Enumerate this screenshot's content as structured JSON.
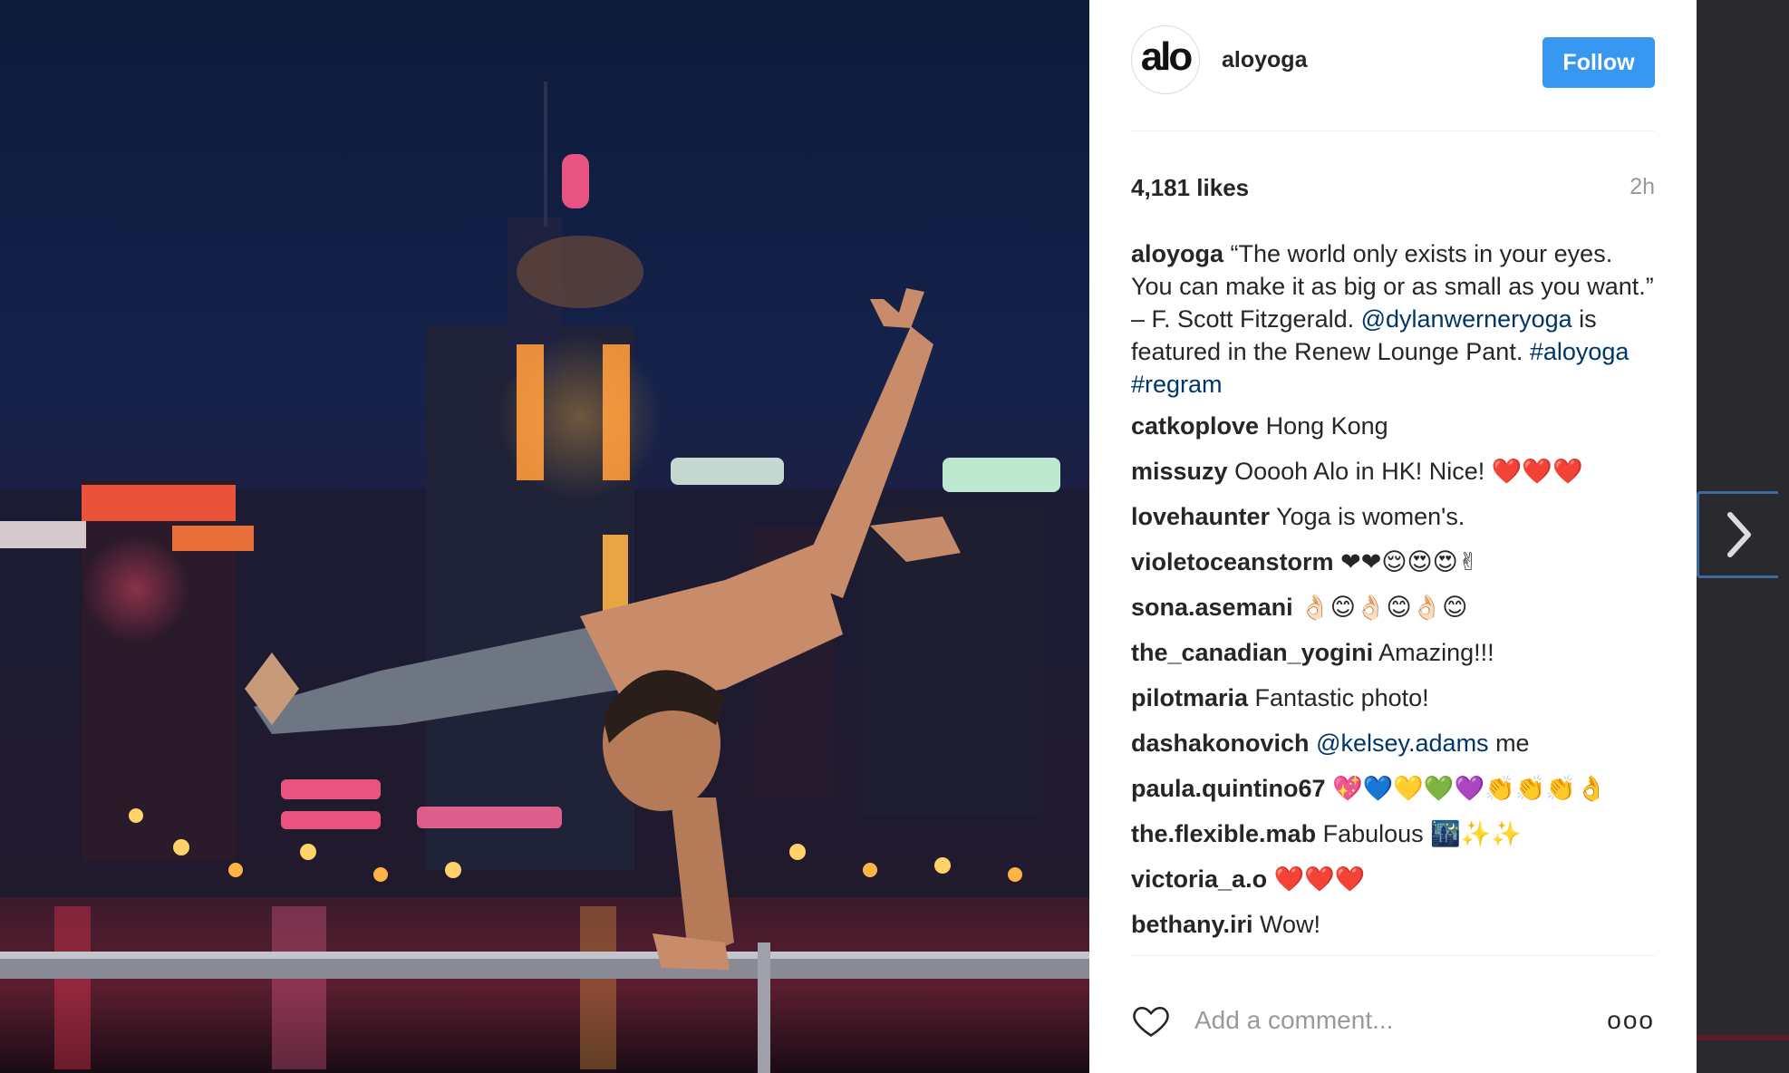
{
  "post": {
    "username": "aloyoga",
    "avatar_text": "alo",
    "follow_label": "Follow",
    "likes": "4,181 likes",
    "time": "2h"
  },
  "caption": {
    "author": "aloyoga",
    "text_1": " “The world only exists in your eyes. You can make it as big or as small as you want.” – F. Scott Fitzgerald. ",
    "mention": "@dylanwerneryoga",
    "text_2": " is featured in the Renew Lounge Pant. ",
    "tag_1": "#aloyoga",
    "tag_2": "#regram"
  },
  "comments": [
    {
      "author": "catkoplove",
      "text": "Hong Kong"
    },
    {
      "author": "missuzy",
      "text": "Ooooh Alo in HK! Nice! ❤️❤️❤️"
    },
    {
      "author": "lovehaunter",
      "text": "Yoga is women's."
    },
    {
      "author": "violetoceanstorm",
      "text": "❤❤😌😍😍✌"
    },
    {
      "author": "sona.asemani",
      "text": "👌🏻😊👌🏻😊👌🏻😊"
    },
    {
      "author": "the_canadian_yogini",
      "text": "Amazing!!!"
    },
    {
      "author": "pilotmaria",
      "text": "Fantastic photo!"
    },
    {
      "author": "dashakonovich",
      "mention": "@kelsey.adams",
      "text": " me"
    },
    {
      "author": "paula.quintino67",
      "text": "💖💙💛💚💜👏👏👏👌"
    },
    {
      "author": "the.flexible.mab",
      "text": "Fabulous 🌃✨✨"
    },
    {
      "author": "victoria_a.o",
      "text": "❤️❤️❤️"
    },
    {
      "author": "bethany.iri",
      "text": "Wow!"
    }
  ],
  "footer": {
    "comment_placeholder": "Add a comment...",
    "more_label": "ooo"
  },
  "icons": {
    "heart": "heart-outline-icon",
    "more": "more-options-icon",
    "next": "chevron-right-icon"
  }
}
